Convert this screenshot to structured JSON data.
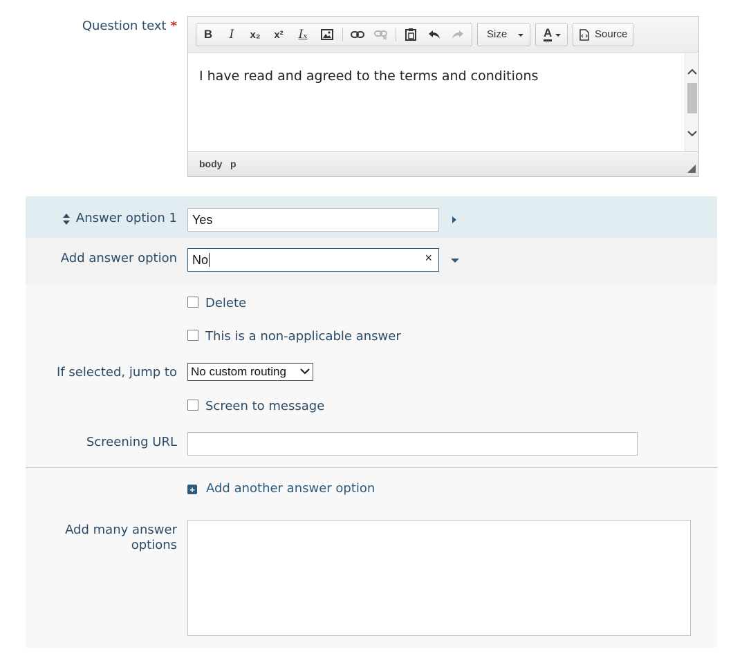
{
  "question": {
    "label": "Question text",
    "required_mark": "*",
    "editor": {
      "toolbar": {
        "bold": "B",
        "italic": "I",
        "subscript": "x₂",
        "superscript": "x²",
        "remove_format": "Iₓ",
        "size_label": "Size",
        "text_color": "A",
        "source_label": "Source"
      },
      "content": "I have read and agreed to the terms and conditions",
      "path": [
        "body",
        "p"
      ]
    }
  },
  "answers": {
    "option1": {
      "label": "Answer option 1",
      "value": "Yes"
    },
    "new_option": {
      "label": "Add answer option",
      "value": "No",
      "clear": "×"
    },
    "delete_label": "Delete",
    "non_applicable_label": "This is a non-applicable answer",
    "routing": {
      "label": "If selected, jump to",
      "selected": "No custom routing"
    },
    "screen_label": "Screen to message",
    "screening_url": {
      "label": "Screening URL",
      "value": ""
    },
    "add_another_label": "Add another answer option",
    "add_many": {
      "label_line1": "Add many answer",
      "label_line2": "options",
      "value": ""
    }
  },
  "colors": {
    "text": "#2c4a66",
    "accent": "#2c5a7c",
    "active_row": "#e2edf2",
    "required": "#c0392b"
  }
}
